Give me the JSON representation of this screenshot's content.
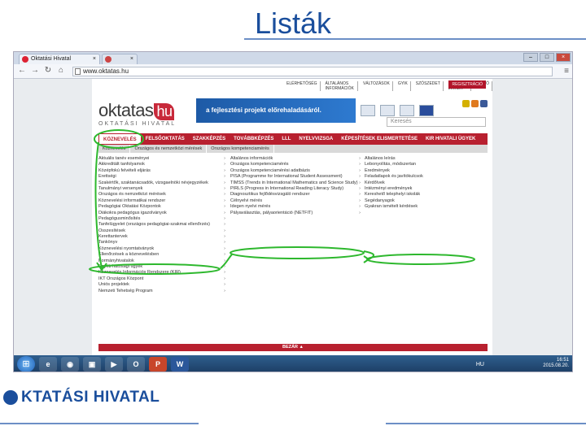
{
  "slide": {
    "title": "Listák",
    "footer_logo": "KTATÁSI HIVATAL"
  },
  "browser": {
    "tabs": [
      {
        "label": "Oktatási Hivatal",
        "close": "×"
      },
      {
        "label": "",
        "close": "×"
      }
    ],
    "url": "www.oktatas.hu",
    "win_controls": [
      "–",
      "□",
      "×"
    ]
  },
  "site": {
    "top_links": [
      "ELÉRHETŐSÉG",
      "ÁLTALÁNOS INFORMÁCIÓK",
      "VÁLTOZÁSOK",
      "GYIK",
      "SZÓSZEDET",
      "OKTATÁSI LINKEK",
      "SAJTÓ"
    ],
    "register": "REGISZTRÁCIÓ",
    "logo_main": "oktatas",
    "logo_hu": "hu",
    "logo_sub": "OKTATÁSI HIVATAL",
    "banner": "a fejlesztési projekt előrehaladásáról.",
    "search_placeholder": "Keresés",
    "main_nav": [
      "KÖZNEVELÉS",
      "FELSŐOKTATÁS",
      "SZAKKÉPZÉS",
      "TOVÁBBKÉPZÉS",
      "LLL",
      "NYELVVIZSGA",
      "KÉPESÍTÉSEK ELISMERTETÉSE",
      "KIR HIVATALI ÜGYEK"
    ],
    "sub_nav": [
      "Köznevelés",
      "Országos és nemzetközi mérések",
      "Országos kompetenciamérés"
    ],
    "col1": [
      "Aktuális tanév eseményei",
      "Akkreditált tanfolyamok",
      "Középfokú felvételi eljárás",
      "Érettségi",
      "Szakértők, szaktanácsadók, vizsgaelnöki névjegyzékek",
      "Tanulmányi versenyek",
      "Országos és nemzetközi mérések",
      "Köznevelési informatikai rendszer",
      "Pedagógiai Oktatási Központok",
      "Diákokra pedagógus igazolványok",
      "Pedagógusminősítés",
      "Tanfelügyelet (országos pedagógiai-szakmai ellenőrzés)",
      "Összesítések",
      "Kerettantervek",
      "Tankönyv",
      "Köznevelési nyomtatványok",
      "Ellenőrzések a köznevelésben",
      "Kormányhivatalok",
      "Egyéb hatósági ügyek",
      "Köznevelés Információs Rendszere (KIR)",
      "IKT Országos Központ",
      "Uniós projektek",
      "Nemzeti Tehetség Program"
    ],
    "col2": [
      "Általános információk",
      "Országos kompetenciamérés",
      "Országos kompetenciamérési adatbázis",
      "PISA (Programme for International Student Assessment)",
      "TIMSS (Trends in International Mathematics and Science Study)",
      "PIRLS (Progress in International Reading Literacy Study)",
      "Diagnosztikus fejlődésvizsgáló rendszer",
      "Célnyelvi mérés",
      "Idegen nyelvi mérés",
      "Pályaválasztás, pályaorientáció (NETFIT)"
    ],
    "col3": [
      "Általános leírás",
      "Lebonyolítás, módszertan",
      "Eredmények",
      "Feladatlapok és javítókulcsok",
      "Kérdőívek",
      "Intézményi eredmények",
      "Kereshető telephelyi iskolák",
      "Segédanyagok",
      "Gyakran ismételt kérdések"
    ],
    "more": "BEZÁR ▲"
  },
  "taskbar": {
    "start": "⊞",
    "apps": [
      "e",
      "◉",
      "▣",
      "▶",
      "O",
      "P",
      "W"
    ],
    "lang": "HU",
    "time": "16:51",
    "date": "2015.08.20."
  },
  "annotation_color": "#2eb82e"
}
